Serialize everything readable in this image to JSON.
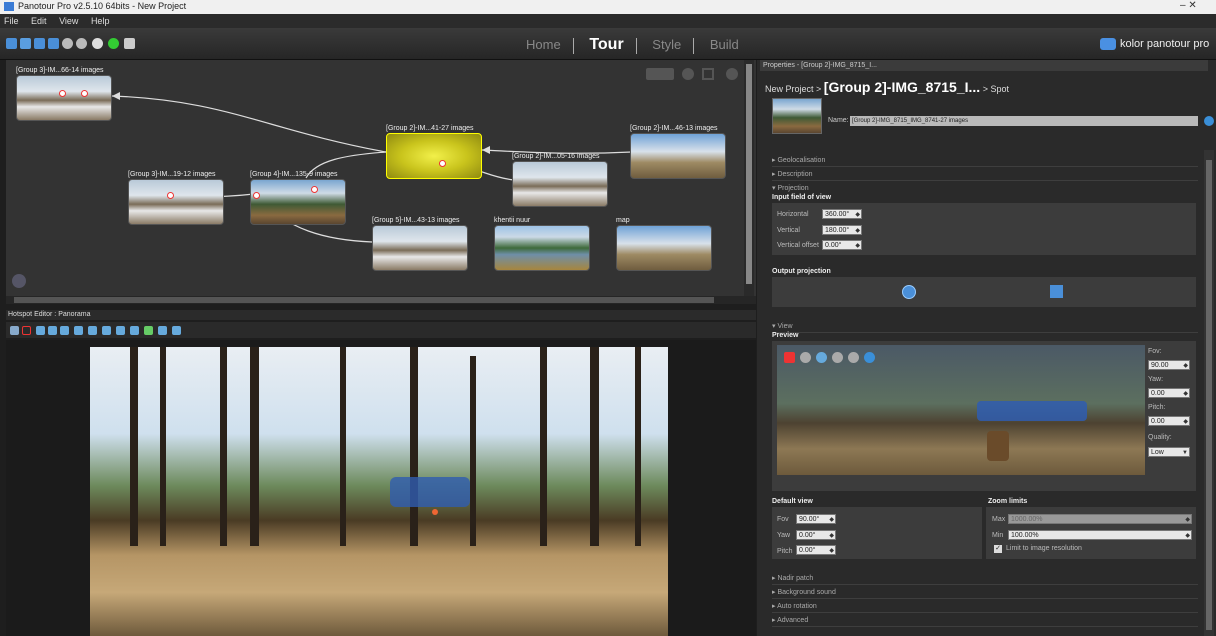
{
  "window": {
    "title": "Panotour Pro v2.5.10 64bits - New Project",
    "controls": "–   ✕"
  },
  "menu": [
    "File",
    "Edit",
    "View",
    "Help"
  ],
  "modes": {
    "home": "Home",
    "tour": "Tour",
    "style": "Style",
    "build": "Build",
    "active": "Tour"
  },
  "brand": "kolor panotour pro",
  "graph": {
    "nodes": [
      {
        "label": "[Group 3]-IM...66-14 images",
        "kind": "snow"
      },
      {
        "label": "[Group 2]-IM...41-27 images",
        "kind": "yellow"
      },
      {
        "label": "[Group 2]-IM...46-13 images",
        "kind": "mtn"
      },
      {
        "label": "[Group 2]-IM...05-16 images",
        "kind": "snow"
      },
      {
        "label": "[Group 3]-IM...19-12 images",
        "kind": "snow"
      },
      {
        "label": "[Group 4]-IM...135-9 images",
        "kind": "forest"
      },
      {
        "label": "[Group 5]-IM...43-13 images",
        "kind": "snow"
      },
      {
        "label": "khentii nuur",
        "kind": "lake"
      },
      {
        "label": "map",
        "kind": "mtn"
      }
    ]
  },
  "hotspot_editor": {
    "title": "Hotspot Editor : Panorama"
  },
  "properties": {
    "header": "Properties - [Group 2]-IMG_8715_I...",
    "breadcrumb_root": "New Project >",
    "breadcrumb_current": "[Group 2]-IMG_8715_I...",
    "breadcrumb_tail": "> Spot",
    "name_label": "Name:",
    "name_value": "[Group 2]-IMG_8715_IMG_8741-27 images",
    "sections": {
      "geolocalisation": "Geolocalisation",
      "description": "Description",
      "projection": "Projection",
      "view": "View",
      "nadir": "Nadir patch",
      "sound": "Background sound",
      "rotation": "Auto rotation",
      "advanced": "Advanced"
    },
    "input_fov": {
      "title": "Input field of view",
      "horizontal_label": "Horizontal",
      "horizontal": "360.00°",
      "vertical_label": "Vertical",
      "vertical": "180.00°",
      "offset_label": "Vertical offset",
      "offset": "0.00°"
    },
    "output_projection": {
      "title": "Output projection"
    },
    "preview": {
      "title": "Preview",
      "fov_label": "Fov:",
      "fov": "90.00",
      "yaw_label": "Yaw:",
      "yaw": "0.00",
      "pitch_label": "Pitch:",
      "pitch": "0.00",
      "quality_label": "Quality:",
      "quality": "Low"
    },
    "default_view": {
      "title": "Default view",
      "fov_label": "Fov",
      "fov": "90.00°",
      "yaw_label": "Yaw",
      "yaw": "0.00°",
      "pitch_label": "Pitch",
      "pitch": "0.00°"
    },
    "zoom_limits": {
      "title": "Zoom limits",
      "max_label": "Max",
      "max": "1000.00%",
      "min_label": "Min",
      "min": "100.00%",
      "limit_label": "Limit to image resolution",
      "limit_checked": true
    }
  }
}
